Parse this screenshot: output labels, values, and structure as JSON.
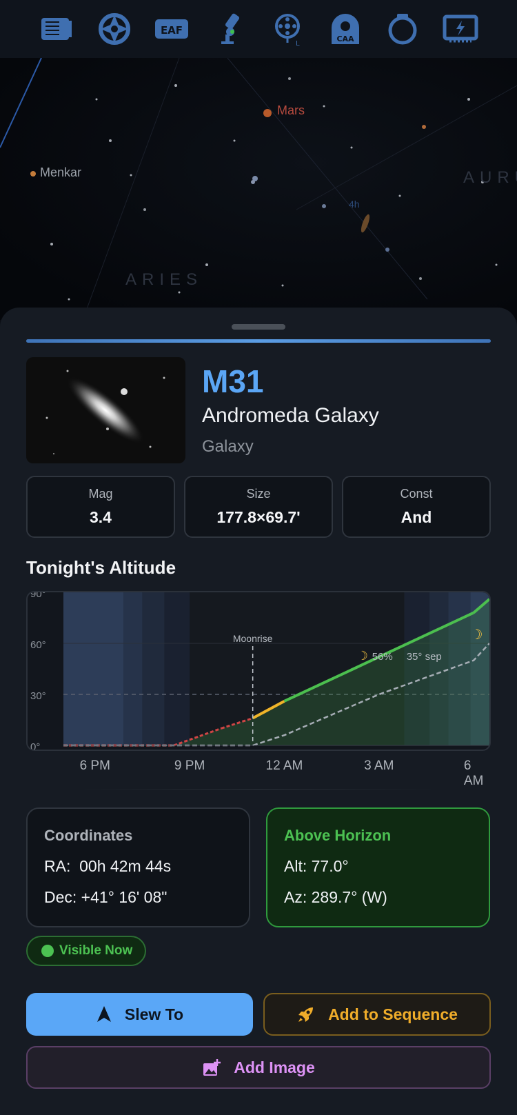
{
  "toolbar": {
    "items": [
      {
        "name": "camera",
        "icon": "camera-icon"
      },
      {
        "name": "filter-wheel",
        "icon": "filter-wheel-icon"
      },
      {
        "name": "eaf",
        "icon": "eaf-icon",
        "label": "EAF"
      },
      {
        "name": "mount",
        "icon": "telescope-mount-icon"
      },
      {
        "name": "guider",
        "icon": "guider-icon",
        "label": "L"
      },
      {
        "name": "caa",
        "icon": "caa-icon",
        "label": "CAA"
      },
      {
        "name": "ring",
        "icon": "ring-icon"
      },
      {
        "name": "power",
        "icon": "power-box-icon"
      }
    ],
    "icon_color": "#3f6fb0"
  },
  "sky_map": {
    "labels": {
      "mars": "Mars",
      "menkar": "Menkar",
      "grid_hour": "4h",
      "constellation_aries": "ARIES",
      "constellation_taurus": "AURU"
    }
  },
  "object": {
    "id": "M31",
    "name": "Andromeda Galaxy",
    "type": "Galaxy",
    "stats": [
      {
        "label": "Mag",
        "value": "3.4"
      },
      {
        "label": "Size",
        "value": "177.8×69.7'"
      },
      {
        "label": "Const",
        "value": "And"
      }
    ]
  },
  "altitude": {
    "title": "Tonight's Altitude",
    "moonrise_label": "Moonrise",
    "moon_phase_label": "56%",
    "moon_sep_label": "35° sep",
    "chart_data": {
      "type": "line",
      "x_tick_labels": [
        "6 PM",
        "9 PM",
        "12 AM",
        "3 AM",
        "6 AM"
      ],
      "y_tick_labels": [
        "90°",
        "60°",
        "30°",
        "0°"
      ],
      "ylim": [
        0,
        90
      ],
      "x_hours": [
        17.5,
        20.5,
        22.0,
        23.0,
        24.0,
        27.0,
        30.0,
        30.5
      ],
      "series": [
        {
          "name": "object",
          "color_low": "#d04545",
          "color_mid": "#f0b429",
          "color_high": "#4cbf4f",
          "x": [
            17.0,
            20.5,
            22.0,
            23.0,
            24.0,
            27.0,
            30.0,
            30.5
          ],
          "y": [
            0,
            0,
            10,
            16,
            26,
            52,
            78,
            86
          ]
        },
        {
          "name": "moon",
          "color": "#a6adb5",
          "x": [
            17.0,
            22.0,
            23.0,
            24.0,
            27.0,
            30.0,
            30.5
          ],
          "y": [
            0,
            0,
            0,
            6,
            30,
            50,
            60
          ]
        }
      ],
      "moonrise_hour": 23.0,
      "threshold_deg": 30
    }
  },
  "coordinates": {
    "title": "Coordinates",
    "ra": "RA:  00h 42m 44s",
    "dec": "Dec: +41° 16' 08\""
  },
  "horizon": {
    "title": "Above Horizon",
    "alt": "Alt: 77.0°",
    "az": "Az: 289.7° (W)",
    "title_color": "#4cc152"
  },
  "visibility_badge": "Visible Now",
  "actions": {
    "slew": "Slew To",
    "sequence": "Add to Sequence",
    "image": "Add Image"
  }
}
